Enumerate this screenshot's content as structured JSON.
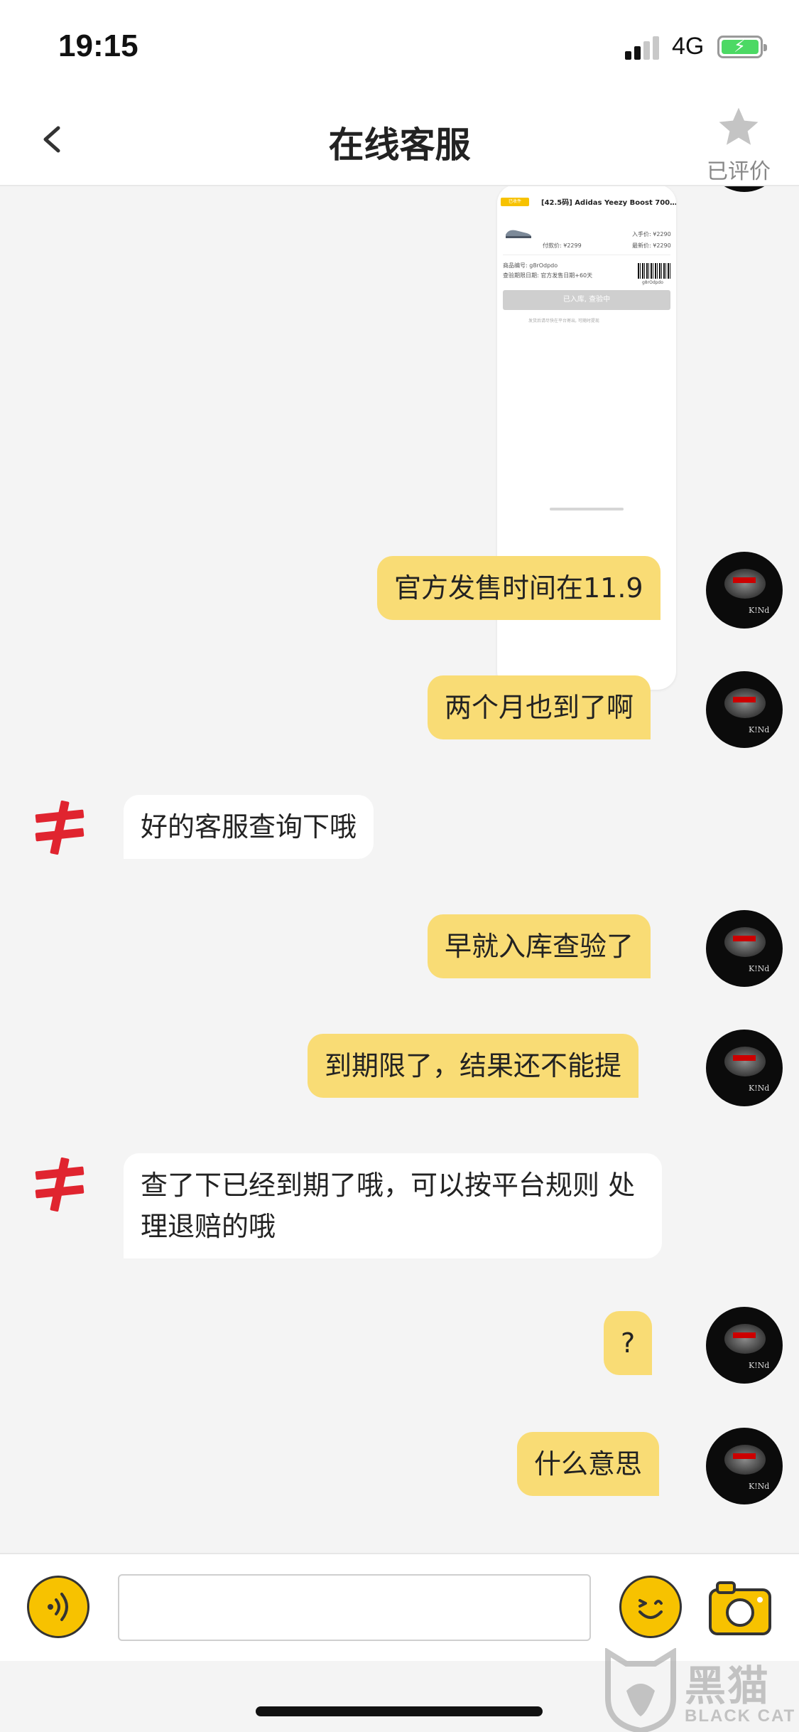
{
  "status_bar": {
    "time": "19:15",
    "network": "4G",
    "battery_state": "charging"
  },
  "header": {
    "title": "在线客服",
    "back_icon": "chevron-left-icon",
    "rating_icon": "star-icon",
    "rating_label": "已评价"
  },
  "order_card": {
    "tag": "已收件",
    "title": "[42.5码] Adidas Yeezy Boost 700…",
    "inbound_price": "入手价: ¥2290",
    "paid_price": "付款价: ¥2299",
    "latest_price": "最新价: ¥2290",
    "order_no_label": "商品编号: g8rOdpdo",
    "deadline": "查验期限日期: 官方发售日期+60天",
    "barcode_text": "g8rOdpdo",
    "status_button": "已入库, 查验中",
    "footnote": "发货后请尽快在平台寄出, 可随时提现"
  },
  "messages": [
    {
      "sender": "user",
      "text": "官方发售时间在11.9"
    },
    {
      "sender": "user",
      "text": "两个月也到了啊"
    },
    {
      "sender": "agent",
      "text": "好的客服查询下哦"
    },
    {
      "sender": "user",
      "text": "早就入库查验了"
    },
    {
      "sender": "user",
      "text": "到期限了，结果还不能提"
    },
    {
      "sender": "agent",
      "text": "查了下已经到期了哦，可以按平台规则 处理退赔的哦"
    },
    {
      "sender": "user",
      "text": "?"
    },
    {
      "sender": "user",
      "text": "什么意思"
    }
  ],
  "input_bar": {
    "voice_icon": "voice-icon",
    "input_value": "",
    "emoji_icon": "emoji-icon",
    "camera_icon": "camera-icon"
  },
  "watermark": {
    "text_cn": "黑猫",
    "text_en": "BLACK CAT"
  },
  "colors": {
    "user_bubble": "#f9dc75",
    "agent_bubble": "#ffffff",
    "accent": "#f7c200",
    "background": "#f4f4f4"
  }
}
